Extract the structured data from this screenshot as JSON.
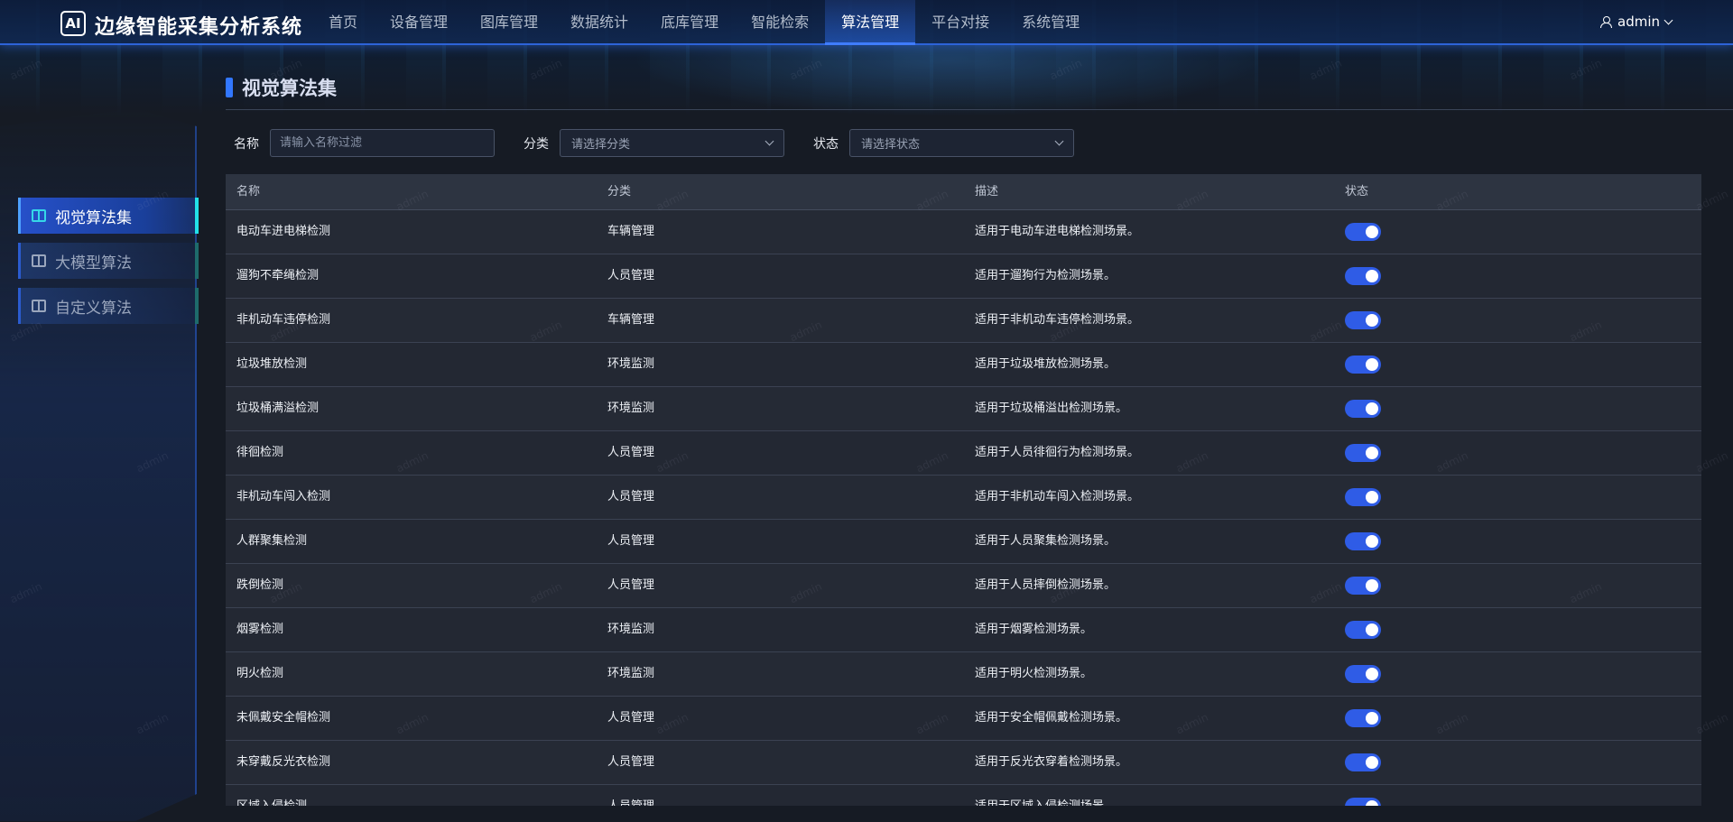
{
  "header": {
    "logo_text": "AI",
    "app_title": "边缘智能采集分析系统",
    "nav": [
      "首页",
      "设备管理",
      "图库管理",
      "数据统计",
      "底库管理",
      "智能检索",
      "算法管理",
      "平台对接",
      "系统管理"
    ],
    "active_nav": "算法管理",
    "user_name": "admin"
  },
  "sidebar": {
    "items": [
      {
        "label": "视觉算法集",
        "active": true
      },
      {
        "label": "大模型算法",
        "active": false
      },
      {
        "label": "自定义算法",
        "active": false
      }
    ]
  },
  "page": {
    "title": "视觉算法集"
  },
  "filters": {
    "name_label": "名称",
    "name_placeholder": "请输入名称过滤",
    "category_label": "分类",
    "category_placeholder": "请选择分类",
    "status_label": "状态",
    "status_placeholder": "请选择状态"
  },
  "table": {
    "columns": [
      "名称",
      "分类",
      "描述",
      "状态"
    ],
    "rows": [
      {
        "name": "电动车进电梯检测",
        "category": "车辆管理",
        "desc": "适用于电动车进电梯检测场景。",
        "enabled": true
      },
      {
        "name": "遛狗不牵绳检测",
        "category": "人员管理",
        "desc": "适用于遛狗行为检测场景。",
        "enabled": true
      },
      {
        "name": "非机动车违停检测",
        "category": "车辆管理",
        "desc": "适用于非机动车违停检测场景。",
        "enabled": true
      },
      {
        "name": "垃圾堆放检测",
        "category": "环境监测",
        "desc": "适用于垃圾堆放检测场景。",
        "enabled": true
      },
      {
        "name": "垃圾桶满溢检测",
        "category": "环境监测",
        "desc": "适用于垃圾桶溢出检测场景。",
        "enabled": true
      },
      {
        "name": "徘徊检测",
        "category": "人员管理",
        "desc": "适用于人员徘徊行为检测场景。",
        "enabled": true
      },
      {
        "name": "非机动车闯入检测",
        "category": "人员管理",
        "desc": "适用于非机动车闯入检测场景。",
        "enabled": true
      },
      {
        "name": "人群聚集检测",
        "category": "人员管理",
        "desc": "适用于人员聚集检测场景。",
        "enabled": true
      },
      {
        "name": "跌倒检测",
        "category": "人员管理",
        "desc": "适用于人员摔倒检测场景。",
        "enabled": true
      },
      {
        "name": "烟雾检测",
        "category": "环境监测",
        "desc": "适用于烟雾检测场景。",
        "enabled": true
      },
      {
        "name": "明火检测",
        "category": "环境监测",
        "desc": "适用于明火检测场景。",
        "enabled": true
      },
      {
        "name": "未佩戴安全帽检测",
        "category": "人员管理",
        "desc": "适用于安全帽佩戴检测场景。",
        "enabled": true
      },
      {
        "name": "未穿戴反光衣检测",
        "category": "人员管理",
        "desc": "适用于反光衣穿着检测场景。",
        "enabled": true
      },
      {
        "name": "区域入侵检测",
        "category": "人员管理",
        "desc": "适用于区域入侵检测场景。",
        "enabled": true
      }
    ]
  },
  "watermark_text": "admin",
  "colors": {
    "accent": "#2f5ce6",
    "active_nav_border": "#3f7cff",
    "sidebar_active_marker": "#22e0e8"
  }
}
